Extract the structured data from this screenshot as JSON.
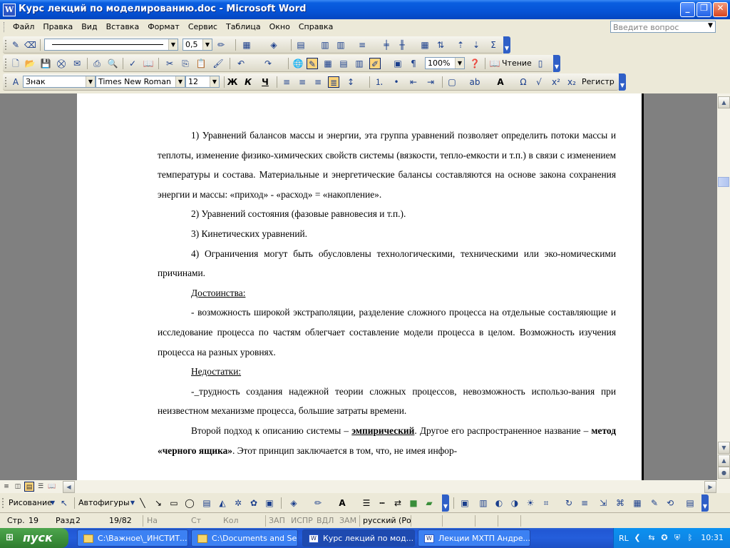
{
  "window": {
    "title": "Курс лекций по моделированию.doc - Microsoft Word",
    "app_icon": "W",
    "buttons": {
      "minimize": "_",
      "maximize": "❐",
      "close": "✕"
    }
  },
  "menu": {
    "items": [
      "Файл",
      "Правка",
      "Вид",
      "Вставка",
      "Формат",
      "Сервис",
      "Таблица",
      "Окно",
      "Справка"
    ],
    "question_placeholder": "Введите вопрос"
  },
  "toolbar_tables": {
    "line_width": "0,5"
  },
  "toolbar_standard": {
    "zoom": "100%",
    "reading": "Чтение"
  },
  "toolbar_format": {
    "style": "Знак",
    "font": "Times New Roman",
    "size": "12",
    "bold": "Ж",
    "italic": "К",
    "underline": "Ч",
    "register": "Регистр"
  },
  "document": {
    "paragraphs": [
      "1) Уравнений балансов массы и энергии, эта группа уравнений позволяет определить потоки массы и теплоты, изменение физико-химических свойств системы (вязкости, тепло-емкости и т.п.) в связи с изменением температуры и состава. Материальные и энергетические балансы составляются на основе закона сохранения энергии и массы: «приход» - «расход» = «накопление».",
      "2) Уравнений состояния (фазовые равновесия и т.п.).",
      "3) Кинетических уравнений.",
      "4) Ограничения могут быть обусловлены технологическими, техническими или эко-номическими причинами."
    ],
    "advantages_heading": "Достоинства:",
    "advantages_text": "- возможность широкой экстраполяции, разделение сложного процесса на отдельные составляющие  и исследование процесса по частям облегчает составление модели процесса в целом. Возможность изучения процесса на разных уровнях.",
    "disadvantages_heading": "Недостатки:",
    "disadvantages_prefix": "-_",
    "disadvantages_text": "трудность создания надежной теории сложных процессов, невозможность использо-вания при неизвестном механизме процесса, большие затраты времени.",
    "last_para_start": "Второй подход к описанию системы – ",
    "last_para_bold1": "эмпирический",
    "last_para_mid": ". Другое его распространенное название – ",
    "last_para_bold2": "метод «черного ящика»",
    "last_para_end": ". Этот принцип заключается в том, что, не имея инфор-"
  },
  "drawing_toolbar": {
    "draw": "Рисование",
    "autoshapes": "Автофигуры"
  },
  "status": {
    "page": "Стр.",
    "page_no": "19",
    "section": "Разд",
    "section_no": "2",
    "pages": "19/82",
    "at": "На",
    "line": "Ст",
    "col": "Кол",
    "rec": "ЗАП",
    "trk": "ИСПР",
    "ext": "ВДЛ",
    "ovr": "ЗАМ",
    "language": "русский (Ро"
  },
  "taskbar": {
    "start": "пуск",
    "tasks": [
      "C:\\Важное\\_ИНСТИТ...",
      "C:\\Documents and Se...",
      "Курс лекций по мод...",
      "Лекции МХТП Андре..."
    ],
    "lang": "RL",
    "clock": "10:31"
  },
  "colors": {
    "titlebar": "#0553d6",
    "taskbar": "#245edb",
    "start": "#3a8e3a"
  }
}
